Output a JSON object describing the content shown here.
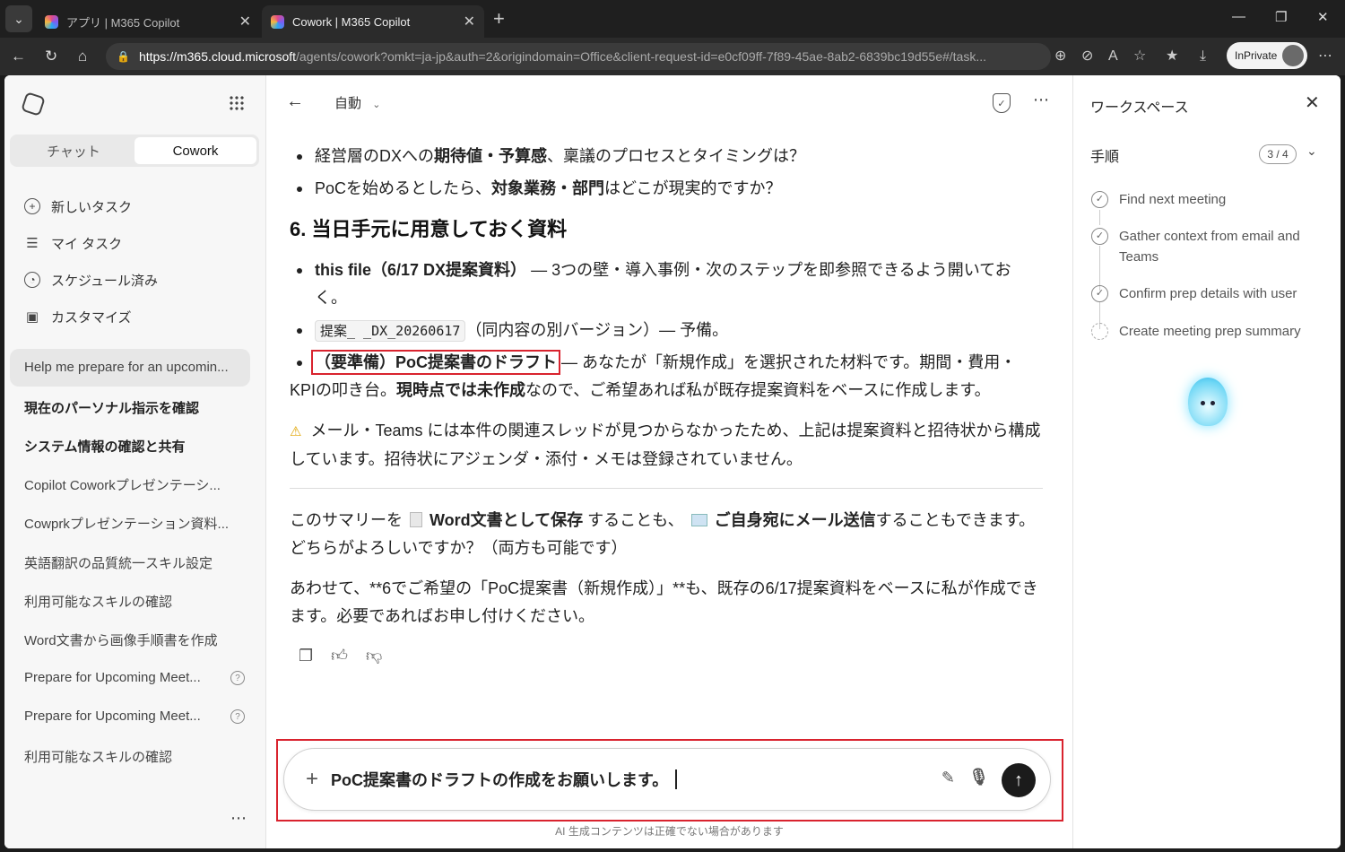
{
  "browser": {
    "tabs": [
      {
        "title": "アプリ | M365 Copilot"
      },
      {
        "title": "Cowork | M365 Copilot"
      }
    ],
    "url_host": "https://m365.cloud.microsoft",
    "url_path": "/agents/cowork?omkt=ja-jp&auth=2&origindomain=Office&client-request-id=e0cf09ff-7f89-45ae-8ab2-6839bc19d55e#/task...",
    "inprivate_label": "InPrivate"
  },
  "sidebar": {
    "segment": {
      "chat": "チャット",
      "cowork": "Cowork"
    },
    "menu": [
      {
        "label": "新しいタスク",
        "icon": "plus-circle-icon"
      },
      {
        "label": "マイ タスク",
        "icon": "task-list-icon"
      },
      {
        "label": "スケジュール済み",
        "icon": "clock-icon"
      },
      {
        "label": "カスタマイズ",
        "icon": "toolbox-icon"
      }
    ],
    "history": [
      "Help me prepare for an upcomin...",
      "現在のパーソナル指示を確認",
      "システム情報の確認と共有",
      "Copilot Coworkプレゼンテーシ...",
      "Cowprkプレゼンテーション資料...",
      "英語翻訳の品質統一スキル設定",
      "利用可能なスキルの確認",
      "Word文書から画像手順書を作成",
      "Prepare for Upcoming Meet...",
      "Prepare for Upcoming Meet...",
      "利用可能なスキルの確認"
    ]
  },
  "main": {
    "mode": "自動",
    "bullets_top": [
      {
        "pre": "経営層のDXへの",
        "b": "期待値・予算感",
        "post": "、稟議のプロセスとタイミングは？"
      },
      {
        "pre": "PoCを始めるとしたら、",
        "b": "対象業務・部門",
        "post": "はどこが現実的ですか？"
      }
    ],
    "heading": "6. 当日手元に用意しておく資料",
    "b1": {
      "b": "this file（6/17 DX提案資料）",
      "post": " — 3つの壁・導入事例・次のステップを即参照できるよう開いてお",
      "wrap": "く。"
    },
    "b2": {
      "code": "提案_           _DX_20260617",
      "post": "（同内容の別バージョン）— 予備。"
    },
    "b3": {
      "hl": "（要準備）PoC提案書のドラフト",
      "post": " — あなたが「新規作成」を選択された材料です。期間・費用・",
      "wrap_pre": "KPIの叩き台。",
      "wrap_b": "現時点では未作成",
      "wrap_post": "なので、ご希望あれば私が既存提案資料をベースに作成します。"
    },
    "warning": "メール・Teams には本件の関連スレッドが見つからなかったため、上記は提案資料と招待状から構成しています。招待状にアジェンダ・添付・メモは登録されていません。",
    "summary": {
      "pre": "このサマリーを",
      "b1": "Word文書として保存",
      "mid": "することも、",
      "b2": "ご自身宛にメール送信",
      "post": "することもできます。どちらがよろしいですか？（両方も可能です）"
    },
    "followup": "あわせて、**6でご希望の「PoC提案書（新規作成）」**も、既存の6/17提案資料をベースに私が作成できます。必要であればお申し付けください。",
    "input_text": "PoC提案書のドラフトの作成をお願いします。",
    "disclaimer": "AI 生成コンテンツは正確でない場合があります"
  },
  "workspace": {
    "title": "ワークスペース",
    "steps_label": "手順",
    "progress": "3 / 4",
    "steps": [
      {
        "label": "Find next meeting",
        "done": true
      },
      {
        "label": "Gather context from email and Teams",
        "done": true
      },
      {
        "label": "Confirm prep details with user",
        "done": true
      },
      {
        "label": "Create meeting prep summary",
        "done": false
      }
    ]
  },
  "colors": {
    "highlight_red": "#d9232e",
    "send_button": "#1b1b1b"
  }
}
